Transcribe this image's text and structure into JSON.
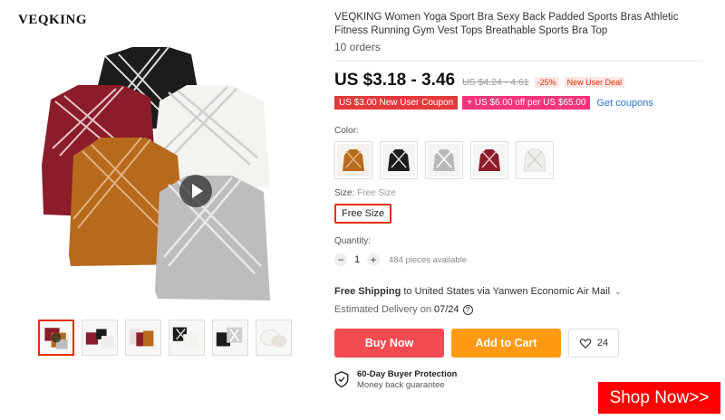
{
  "brand": "VEQKING",
  "product": {
    "title": "VEQKING Women Yoga Sport Bra Sexy Back Padded Sports Bras Athletic Fitness Running Gym Vest Tops Breathable Sports Bra Top",
    "orders": "10 orders"
  },
  "pricing": {
    "price_range": "US $3.18 - 3.46",
    "original_price": "US $4.24 - 4.61",
    "discount": "-25%",
    "deal_badge": "New User Deal"
  },
  "coupons": {
    "new_user_coupon": "US $3.00 New User Coupon",
    "store_coupon": "+ US $6.00 off per US $65.00",
    "get_coupons": "Get coupons"
  },
  "color": {
    "label": "Color:",
    "options": [
      {
        "name": "orange",
        "hex": "#b86a1c"
      },
      {
        "name": "black",
        "hex": "#1c1c1c"
      },
      {
        "name": "gray",
        "hex": "#b9b9b9"
      },
      {
        "name": "wine-red",
        "hex": "#8b1c2a"
      },
      {
        "name": "white",
        "hex": "#f2f2f2"
      }
    ]
  },
  "size": {
    "label": "Size:",
    "selected_text": "Free Size",
    "option": "Free Size"
  },
  "quantity": {
    "label": "Quantity:",
    "minus": "−",
    "value": "1",
    "plus": "+",
    "available": "484 pieces available"
  },
  "shipping": {
    "free": "Free Shipping",
    "destination": " to United States via Yanwen Economic Air Mail",
    "chevron": "⌄",
    "estimated_label": "Estimated Delivery on",
    "estimated_date": "07/24",
    "help": "?"
  },
  "actions": {
    "buy_now": "Buy Now",
    "add_to_cart": "Add to Cart",
    "wishlist_count": "24"
  },
  "protection": {
    "title": "60-Day Buyer Protection",
    "subtitle": "Money back guarantee"
  },
  "banner": {
    "shop_now": "Shop Now>>"
  },
  "colors": {
    "accent_red": "#e62e04",
    "buy_now_bg": "#f24b50",
    "add_to_cart_bg": "#ff9a12",
    "shop_now_bg": "#ff0000",
    "link_blue": "#2b73c5"
  }
}
